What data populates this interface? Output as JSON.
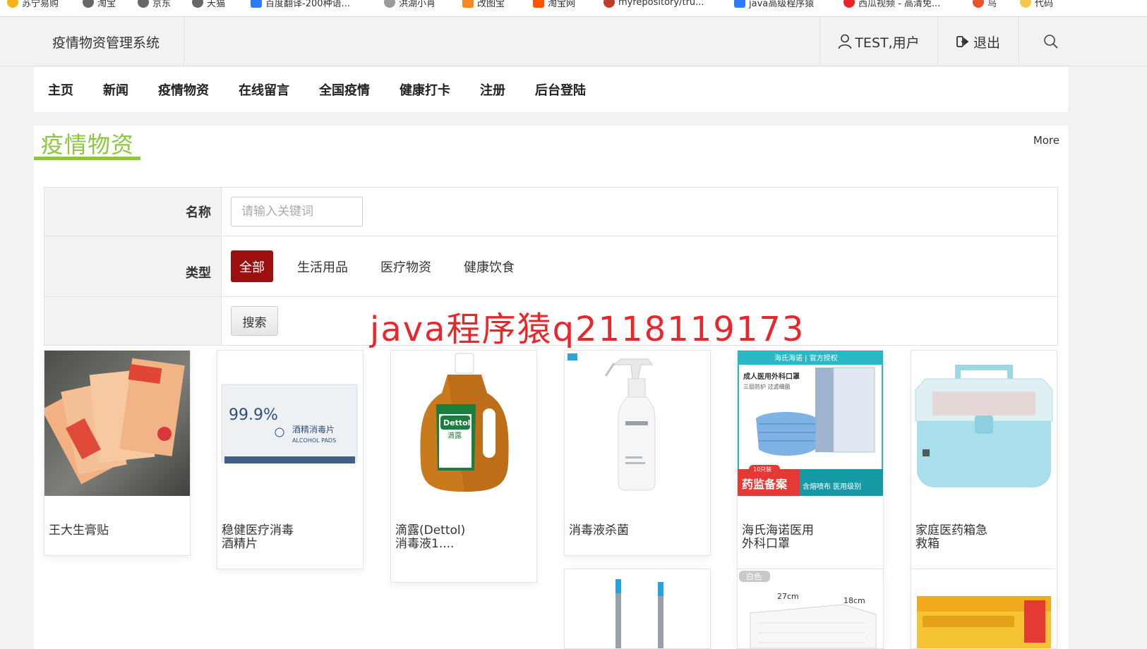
{
  "bookmarks": [
    {
      "label": "苏宁易购",
      "color": "#f6b21a"
    },
    {
      "label": "淘宝",
      "color": "#666666"
    },
    {
      "label": "京东",
      "color": "#666666"
    },
    {
      "label": "天猫",
      "color": "#666666"
    },
    {
      "label": "百度翻译-200种语...",
      "color": "#2d7cf6"
    },
    {
      "label": "洪湖小肖",
      "color": "#7a7a7a"
    },
    {
      "label": "改图宝",
      "color": "#f6891f"
    },
    {
      "label": "淘宝网",
      "color": "#ff5000"
    },
    {
      "label": "myrepository/tru...",
      "color": "#c0392b"
    },
    {
      "label": "java高级程序猿",
      "color": "#2d7cf6"
    },
    {
      "label": "西瓜视频 - 高清免...",
      "color": "#e62429"
    },
    {
      "label": "鸟",
      "color": "#e8532a"
    },
    {
      "label": "代码",
      "color": "#f2c94c"
    }
  ],
  "header": {
    "brand": "疫情物资管理系统",
    "user_label": "TEST,用户",
    "logout_label": "退出"
  },
  "nav": {
    "items": [
      "主页",
      "新闻",
      "疫情物资",
      "在线留言",
      "全国疫情",
      "健康打卡",
      "注册",
      "后台登陆"
    ]
  },
  "section": {
    "title": "疫情物资",
    "more": "More",
    "accent": "#8dc63f"
  },
  "filter": {
    "name_label": "名称",
    "name_placeholder": "请输入关键词",
    "type_label": "类型",
    "types": [
      "全部",
      "生活用品",
      "医疗物资",
      "健康饮食"
    ],
    "active_type": "全部",
    "active_color": "#9b0f0f",
    "search_label": "搜索"
  },
  "watermark": "java程序猿q2118119173",
  "products": [
    {
      "name": "王大生膏贴"
    },
    {
      "name": "稳健医疗消毒酒精片"
    },
    {
      "name": "滴露(Dettol)消毒液1...."
    },
    {
      "name": "消毒液杀菌"
    },
    {
      "name": "海氏海诺医用外科口罩"
    },
    {
      "name": "家庭医药箱急救箱"
    }
  ],
  "product_images_text": {
    "alcohol_pads": {
      "percent": "99.9%",
      "title": "酒精消毒片",
      "sub": "ALCOHOL PADS"
    },
    "dettol": {
      "brand": "Dettol",
      "cn": "滴露"
    },
    "mask": {
      "banner": "海氏海诺 | 官方授权",
      "line1": "成人医用外科口罩",
      "line2": "三层防护  过滤细菌",
      "badge": "药监备案",
      "pack": "10只装",
      "tag": "含熔喷布 医用级别"
    },
    "basket": {
      "tag": "白色",
      "w": "27cm",
      "d": "18cm"
    }
  }
}
